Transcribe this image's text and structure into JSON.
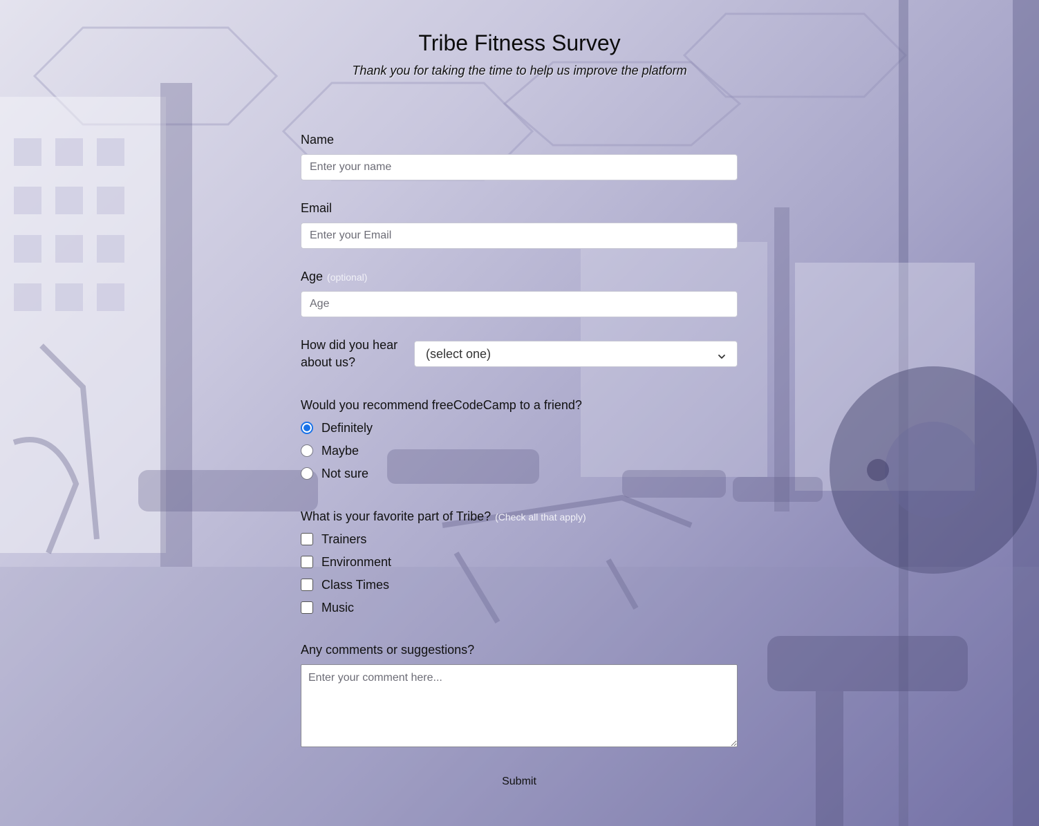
{
  "header": {
    "title": "Tribe Fitness Survey",
    "subtitle": "Thank you for taking the time to help us improve the platform"
  },
  "form": {
    "name": {
      "label": "Name",
      "placeholder": "Enter your name",
      "value": ""
    },
    "email": {
      "label": "Email",
      "placeholder": "Enter your Email",
      "value": ""
    },
    "age": {
      "label": "Age",
      "hint": "(optional)",
      "placeholder": "Age",
      "value": ""
    },
    "referral": {
      "label": "How did you hear about us?",
      "selected": "(select one)",
      "icon": "chevron-down-icon"
    },
    "recommend": {
      "label": "Would you recommend freeCodeCamp to a friend?",
      "options": [
        "Definitely",
        "Maybe",
        "Not sure"
      ],
      "selected": "Definitely"
    },
    "favorite": {
      "label": "What is your favorite part of Tribe?",
      "hint": "(Check all that apply)",
      "options": [
        "Trainers",
        "Environment",
        "Class Times",
        "Music"
      ],
      "checked": []
    },
    "comments": {
      "label": "Any comments or suggestions?",
      "placeholder": "Enter your comment here...",
      "value": ""
    },
    "submit_label": "Submit"
  },
  "colors": {
    "accent": "#1a73e8",
    "background_light": "#e4e3ee",
    "background_dark": "#6f6ca4"
  }
}
